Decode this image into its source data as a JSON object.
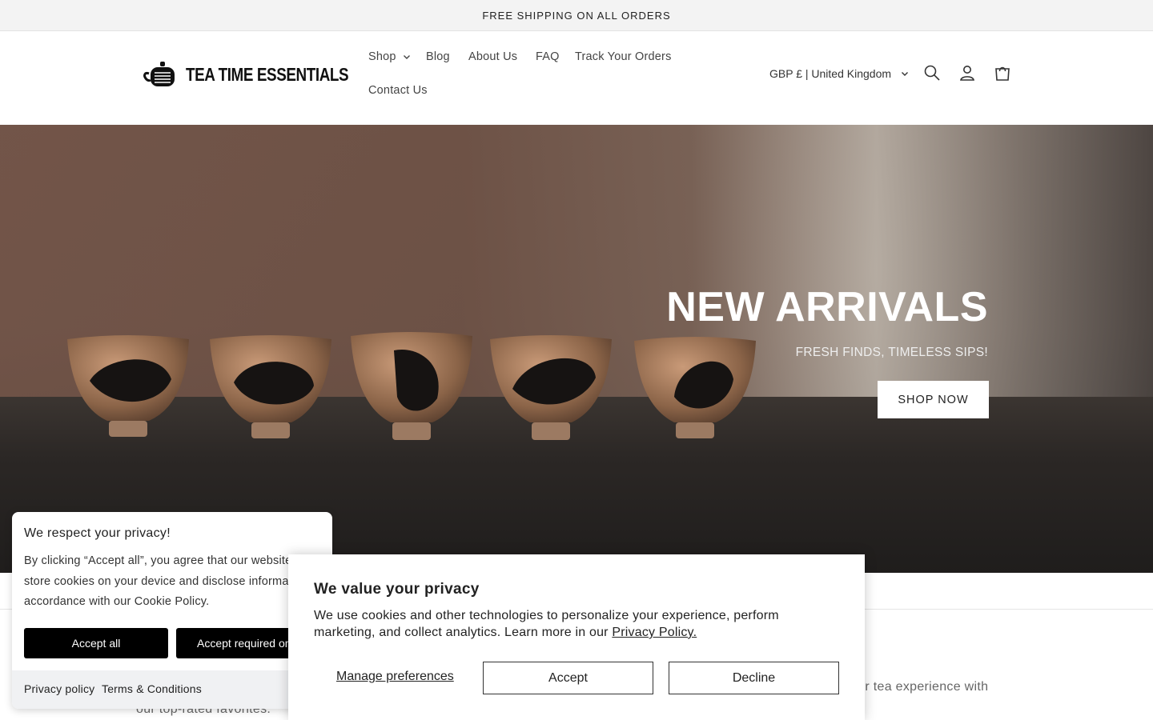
{
  "announcement": "FREE SHIPPING ON ALL ORDERS",
  "header": {
    "logo_text": "TEA TIME ESSENTIALS",
    "nav": [
      {
        "label": "Shop"
      },
      {
        "label": "Blog"
      },
      {
        "label": "About Us"
      },
      {
        "label": "FAQ"
      },
      {
        "label": "Track Your Orders"
      },
      {
        "label": "Contact Us"
      }
    ],
    "currency": "GBP £ | United Kingdom",
    "icons": [
      "search-icon",
      "account-icon",
      "cart-icon"
    ]
  },
  "hero": {
    "title": "NEW ARRIVALS",
    "subtitle": "FRESH FINDS, TIMELESS SIPS!",
    "cta": "SHOP NOW"
  },
  "background": {
    "text_right": "our tea experience with",
    "text_left": "our top-rated favorites."
  },
  "cookie_left": {
    "title": "We respect your privacy!",
    "body": "By clicking “Accept all”, you agree that our website can store cookies on your device and disclose information in accordance with our Cookie Policy.",
    "accept_all": "Accept all",
    "accept_required": "Accept required only",
    "privacy_policy": "Privacy policy",
    "terms": "Terms & Conditions"
  },
  "cookie_main": {
    "title": "We value your privacy",
    "body": "We use cookies and other technologies to personalize your experience, perform marketing, and collect analytics. Learn more in our",
    "link": "Privacy Policy.",
    "manage": "Manage preferences",
    "accept": "Accept",
    "decline": "Decline"
  },
  "colors": {
    "announcement_bg": "#f3f3f3",
    "button_dark": "#000000",
    "hero_text": "#ffffff"
  }
}
